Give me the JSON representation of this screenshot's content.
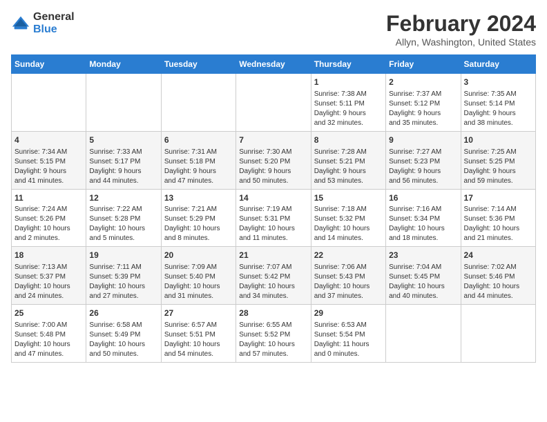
{
  "header": {
    "logo_general": "General",
    "logo_blue": "Blue",
    "title": "February 2024",
    "subtitle": "Allyn, Washington, United States"
  },
  "weekdays": [
    "Sunday",
    "Monday",
    "Tuesday",
    "Wednesday",
    "Thursday",
    "Friday",
    "Saturday"
  ],
  "weeks": [
    [
      {
        "day": "",
        "info": ""
      },
      {
        "day": "",
        "info": ""
      },
      {
        "day": "",
        "info": ""
      },
      {
        "day": "",
        "info": ""
      },
      {
        "day": "1",
        "info": "Sunrise: 7:38 AM\nSunset: 5:11 PM\nDaylight: 9 hours\nand 32 minutes."
      },
      {
        "day": "2",
        "info": "Sunrise: 7:37 AM\nSunset: 5:12 PM\nDaylight: 9 hours\nand 35 minutes."
      },
      {
        "day": "3",
        "info": "Sunrise: 7:35 AM\nSunset: 5:14 PM\nDaylight: 9 hours\nand 38 minutes."
      }
    ],
    [
      {
        "day": "4",
        "info": "Sunrise: 7:34 AM\nSunset: 5:15 PM\nDaylight: 9 hours\nand 41 minutes."
      },
      {
        "day": "5",
        "info": "Sunrise: 7:33 AM\nSunset: 5:17 PM\nDaylight: 9 hours\nand 44 minutes."
      },
      {
        "day": "6",
        "info": "Sunrise: 7:31 AM\nSunset: 5:18 PM\nDaylight: 9 hours\nand 47 minutes."
      },
      {
        "day": "7",
        "info": "Sunrise: 7:30 AM\nSunset: 5:20 PM\nDaylight: 9 hours\nand 50 minutes."
      },
      {
        "day": "8",
        "info": "Sunrise: 7:28 AM\nSunset: 5:21 PM\nDaylight: 9 hours\nand 53 minutes."
      },
      {
        "day": "9",
        "info": "Sunrise: 7:27 AM\nSunset: 5:23 PM\nDaylight: 9 hours\nand 56 minutes."
      },
      {
        "day": "10",
        "info": "Sunrise: 7:25 AM\nSunset: 5:25 PM\nDaylight: 9 hours\nand 59 minutes."
      }
    ],
    [
      {
        "day": "11",
        "info": "Sunrise: 7:24 AM\nSunset: 5:26 PM\nDaylight: 10 hours\nand 2 minutes."
      },
      {
        "day": "12",
        "info": "Sunrise: 7:22 AM\nSunset: 5:28 PM\nDaylight: 10 hours\nand 5 minutes."
      },
      {
        "day": "13",
        "info": "Sunrise: 7:21 AM\nSunset: 5:29 PM\nDaylight: 10 hours\nand 8 minutes."
      },
      {
        "day": "14",
        "info": "Sunrise: 7:19 AM\nSunset: 5:31 PM\nDaylight: 10 hours\nand 11 minutes."
      },
      {
        "day": "15",
        "info": "Sunrise: 7:18 AM\nSunset: 5:32 PM\nDaylight: 10 hours\nand 14 minutes."
      },
      {
        "day": "16",
        "info": "Sunrise: 7:16 AM\nSunset: 5:34 PM\nDaylight: 10 hours\nand 18 minutes."
      },
      {
        "day": "17",
        "info": "Sunrise: 7:14 AM\nSunset: 5:36 PM\nDaylight: 10 hours\nand 21 minutes."
      }
    ],
    [
      {
        "day": "18",
        "info": "Sunrise: 7:13 AM\nSunset: 5:37 PM\nDaylight: 10 hours\nand 24 minutes."
      },
      {
        "day": "19",
        "info": "Sunrise: 7:11 AM\nSunset: 5:39 PM\nDaylight: 10 hours\nand 27 minutes."
      },
      {
        "day": "20",
        "info": "Sunrise: 7:09 AM\nSunset: 5:40 PM\nDaylight: 10 hours\nand 31 minutes."
      },
      {
        "day": "21",
        "info": "Sunrise: 7:07 AM\nSunset: 5:42 PM\nDaylight: 10 hours\nand 34 minutes."
      },
      {
        "day": "22",
        "info": "Sunrise: 7:06 AM\nSunset: 5:43 PM\nDaylight: 10 hours\nand 37 minutes."
      },
      {
        "day": "23",
        "info": "Sunrise: 7:04 AM\nSunset: 5:45 PM\nDaylight: 10 hours\nand 40 minutes."
      },
      {
        "day": "24",
        "info": "Sunrise: 7:02 AM\nSunset: 5:46 PM\nDaylight: 10 hours\nand 44 minutes."
      }
    ],
    [
      {
        "day": "25",
        "info": "Sunrise: 7:00 AM\nSunset: 5:48 PM\nDaylight: 10 hours\nand 47 minutes."
      },
      {
        "day": "26",
        "info": "Sunrise: 6:58 AM\nSunset: 5:49 PM\nDaylight: 10 hours\nand 50 minutes."
      },
      {
        "day": "27",
        "info": "Sunrise: 6:57 AM\nSunset: 5:51 PM\nDaylight: 10 hours\nand 54 minutes."
      },
      {
        "day": "28",
        "info": "Sunrise: 6:55 AM\nSunset: 5:52 PM\nDaylight: 10 hours\nand 57 minutes."
      },
      {
        "day": "29",
        "info": "Sunrise: 6:53 AM\nSunset: 5:54 PM\nDaylight: 11 hours\nand 0 minutes."
      },
      {
        "day": "",
        "info": ""
      },
      {
        "day": "",
        "info": ""
      }
    ]
  ]
}
